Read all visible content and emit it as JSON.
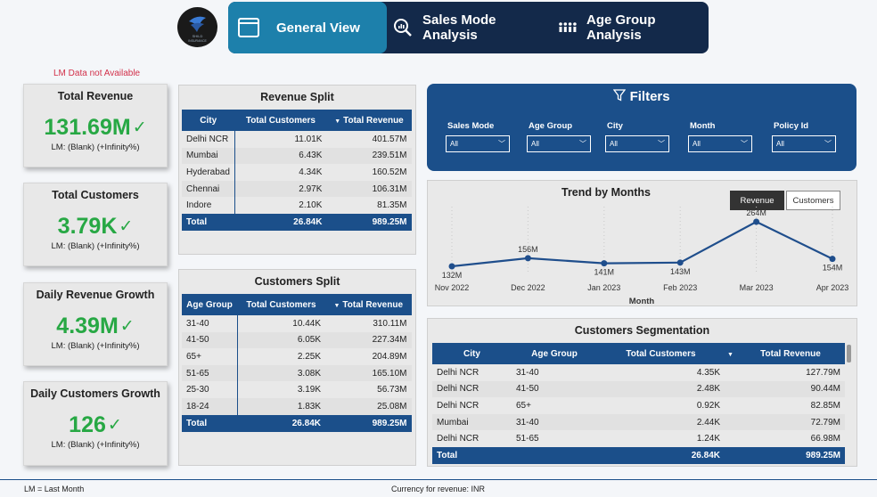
{
  "header": {
    "logo_text": "SHILD INSURANCE",
    "tabs": [
      {
        "label": "General View",
        "active": true
      },
      {
        "label": "Sales Mode Analysis",
        "active": false
      },
      {
        "label": "Age Group Analysis",
        "active": false
      }
    ]
  },
  "lm_warning": "LM Data not Available",
  "kpis": [
    {
      "title": "Total Revenue",
      "value": "131.69M",
      "sub": "LM: (Blank) (+Infinity%)"
    },
    {
      "title": "Total Customers",
      "value": "3.79K",
      "sub": "LM: (Blank) (+Infinity%)"
    },
    {
      "title": "Daily Revenue Growth",
      "value": "4.39M",
      "sub": "LM: (Blank) (+Infinity%)"
    },
    {
      "title": "Daily Customers Growth",
      "value": "126",
      "sub": "LM: (Blank) (+Infinity%)"
    }
  ],
  "revenue_split": {
    "title": "Revenue Split",
    "headers": [
      "City",
      "Total Customers",
      "Total Revenue"
    ],
    "rows": [
      [
        "Delhi NCR",
        "11.01K",
        "401.57M"
      ],
      [
        "Mumbai",
        "6.43K",
        "239.51M"
      ],
      [
        "Hyderabad",
        "4.34K",
        "160.52M"
      ],
      [
        "Chennai",
        "2.97K",
        "106.31M"
      ],
      [
        "Indore",
        "2.10K",
        "81.35M"
      ]
    ],
    "total": [
      "Total",
      "26.84K",
      "989.25M"
    ]
  },
  "customers_split": {
    "title": "Customers Split",
    "headers": [
      "Age Group",
      "Total Customers",
      "Total Revenue"
    ],
    "rows": [
      [
        "31-40",
        "10.44K",
        "310.11M"
      ],
      [
        "41-50",
        "6.05K",
        "227.34M"
      ],
      [
        "65+",
        "2.25K",
        "204.89M"
      ],
      [
        "51-65",
        "3.08K",
        "165.10M"
      ],
      [
        "25-30",
        "3.19K",
        "56.73M"
      ],
      [
        "18-24",
        "1.83K",
        "25.08M"
      ]
    ],
    "total": [
      "Total",
      "26.84K",
      "989.25M"
    ]
  },
  "filters": {
    "title": "Filters",
    "slicers": [
      {
        "label": "Sales Mode",
        "value": "All"
      },
      {
        "label": "Age Group",
        "value": "All"
      },
      {
        "label": "City",
        "value": "All"
      },
      {
        "label": "Month",
        "value": "All"
      },
      {
        "label": "Policy Id",
        "value": "All"
      }
    ]
  },
  "trend": {
    "title": "Trend by Months",
    "toggle": [
      "Revenue",
      "Customers"
    ]
  },
  "chart_data": {
    "type": "line",
    "title": "Trend by Months",
    "xlabel": "Month",
    "ylabel": "",
    "categories": [
      "Nov 2022",
      "Dec 2022",
      "Jan 2023",
      "Feb 2023",
      "Mar 2023",
      "Apr 2023"
    ],
    "values": [
      132,
      156,
      141,
      143,
      264,
      154
    ],
    "labels": [
      "132M",
      "156M",
      "141M",
      "143M",
      "264M",
      "154M"
    ],
    "ylim": [
      110,
      280
    ],
    "line_color": "#1f4e8c"
  },
  "segmentation": {
    "title": "Customers Segmentation",
    "headers": [
      "City",
      "Age Group",
      "Total Customers",
      "Total Revenue"
    ],
    "rows": [
      [
        "Delhi NCR",
        "31-40",
        "4.35K",
        "127.79M"
      ],
      [
        "Delhi NCR",
        "41-50",
        "2.48K",
        "90.44M"
      ],
      [
        "Delhi NCR",
        "65+",
        "0.92K",
        "82.85M"
      ],
      [
        "Mumbai",
        "31-40",
        "2.44K",
        "72.79M"
      ],
      [
        "Delhi NCR",
        "51-65",
        "1.24K",
        "66.98M"
      ]
    ],
    "total": [
      "Total",
      "",
      "26.84K",
      "989.25M"
    ]
  },
  "footer": {
    "left": "LM = Last Month",
    "center": "Currency for revenue: INR"
  }
}
